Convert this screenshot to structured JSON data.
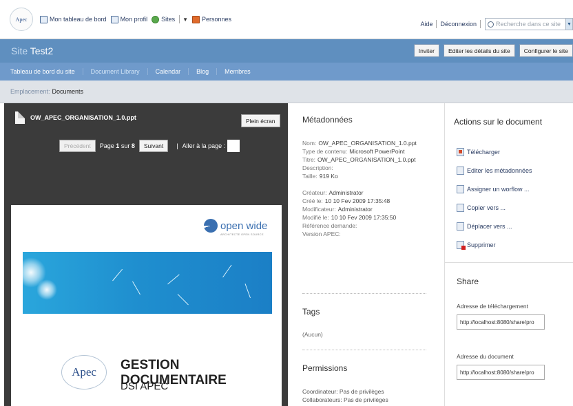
{
  "header": {
    "logo_text": "Apec",
    "nav": [
      {
        "label": "Mon tableau de bord",
        "icon": "dashboard-icon"
      },
      {
        "label": "Mon profil",
        "icon": "profile-icon"
      },
      {
        "label": "Sites",
        "icon": "sites-icon"
      },
      {
        "label": "Personnes",
        "icon": "people-icon"
      }
    ],
    "help": "Aide",
    "logout": "Déconnexion",
    "search_placeholder": "Recherche dans ce site"
  },
  "site": {
    "prefix": "Site",
    "name": "Test2",
    "actions": [
      "Inviter",
      "Editer les détails du site",
      "Configurer le site"
    ]
  },
  "subnav": [
    "Tableau de bord du site",
    "Document Library",
    "Calendar",
    "Blog",
    "Membres"
  ],
  "breadcrumb": {
    "label": "Emplacement:",
    "value": "Documents"
  },
  "viewer": {
    "filename": "OW_APEC_ORGANISATION_1.0.ppt",
    "fullscreen": "Plein écran",
    "prev": "Précédent",
    "page_prefix": "Page",
    "page_current": "1",
    "page_of": "sur",
    "page_total": "8",
    "next": "Suivant",
    "divider": "|",
    "goto": "Aller à la page :",
    "slide": {
      "brand": "open wide",
      "brand_sub": "ARCHITECTE OPEN SOURCE",
      "logo": "Apec",
      "title": "GESTION DOCUMENTAIRE",
      "subtitle": "DSI APEC"
    }
  },
  "metadata": {
    "heading": "Métadonnées",
    "fields": [
      {
        "k": "Nom:",
        "v": "OW_APEC_ORGANISATION_1.0.ppt"
      },
      {
        "k": "Type de contenu:",
        "v": "Microsoft PowerPoint"
      },
      {
        "k": "Titre:",
        "v": "OW_APEC_ORGANISATION_1.0.ppt"
      },
      {
        "k": "Description:",
        "v": ""
      },
      {
        "k": "Taille:",
        "v": "919 Ko"
      }
    ],
    "fields2": [
      {
        "k": "Créateur:",
        "v": "Administrator"
      },
      {
        "k": "Créé le:",
        "v": "10 10 Fev 2009 17:35:48"
      },
      {
        "k": "Modificateur:",
        "v": "Administrator"
      },
      {
        "k": "Modifié le:",
        "v": "10 10 Fev 2009 17:35:50"
      },
      {
        "k": "Référence demande:",
        "v": ""
      },
      {
        "k": "Version APEC:",
        "v": ""
      }
    ],
    "tags_heading": "Tags",
    "tags_value": "(Aucun)",
    "perms_heading": "Permissions",
    "perms": [
      {
        "k": "Coordinateur:",
        "v": "Pas de privilèges"
      },
      {
        "k": "Collaborateurs:",
        "v": "Pas de privilèges"
      }
    ]
  },
  "actions": {
    "heading": "Actions sur le document",
    "items": [
      {
        "label": "Télécharger",
        "icon": "download-icon"
      },
      {
        "label": "Editer les métadonnées",
        "icon": "edit-metadata-icon"
      },
      {
        "label": "Assigner un worflow ...",
        "icon": "workflow-icon"
      },
      {
        "label": "Copier vers ...",
        "icon": "copy-icon"
      },
      {
        "label": "Déplacer vers ...",
        "icon": "move-icon"
      },
      {
        "label": "Supprimer",
        "icon": "delete-icon"
      }
    ],
    "share_heading": "Share",
    "share": [
      {
        "label": "Adresse de téléchargement",
        "value": "http://localhost:8080/share/pro"
      },
      {
        "label": "Adresse du document",
        "value": "http://localhost:8080/share/pro"
      }
    ]
  }
}
